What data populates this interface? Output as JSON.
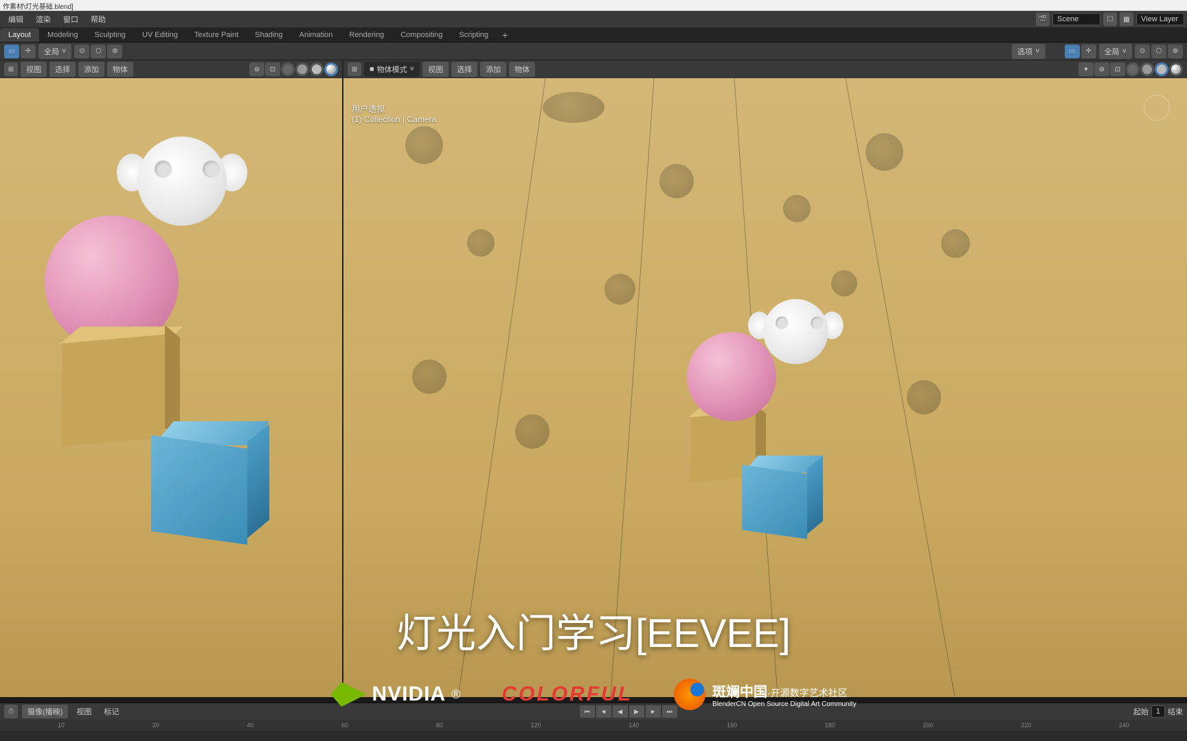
{
  "title_bar": "作素材\\灯光基础.blend]",
  "menu": {
    "items": [
      "编辑",
      "渲染",
      "窗口",
      "帮助"
    ]
  },
  "scene_controls": {
    "scene": "Scene",
    "view_layer": "View Layer"
  },
  "workspace_tabs": [
    "Layout",
    "Modeling",
    "Sculpting",
    "UV Editing",
    "Texture Paint",
    "Shading",
    "Animation",
    "Rendering",
    "Compositing",
    "Scripting"
  ],
  "toolbar": {
    "transform": "全局",
    "options": "选项"
  },
  "viewport_left": {
    "header_tabs": [
      "视图",
      "选择",
      "添加",
      "物体"
    ]
  },
  "viewport_right": {
    "mode": "物体模式",
    "header_tabs": [
      "视图",
      "选择",
      "添加",
      "物体"
    ],
    "info_line1": "用户透视",
    "info_line2": "(1) Collection | Camera",
    "transform": "全局"
  },
  "timeline": {
    "dropdown": "摄像(播映)",
    "tabs": [
      "视图",
      "标记"
    ],
    "frames": [
      "10",
      "20",
      "40",
      "60",
      "80",
      "120",
      "140",
      "160",
      "180",
      "200",
      "220",
      "240"
    ],
    "start_label": "起始",
    "start_value": "1",
    "end_label": "结束"
  },
  "overlay": {
    "title": "灯光入门学习[EEVEE]",
    "nvidia": "NVIDIA",
    "colorful": "COLORFUL",
    "blendercn_main": "斑斓中国",
    "blendercn_tag": "·开源数字艺术社区",
    "blendercn_sub": "BlenderCN Open Source Digital Art Community"
  }
}
